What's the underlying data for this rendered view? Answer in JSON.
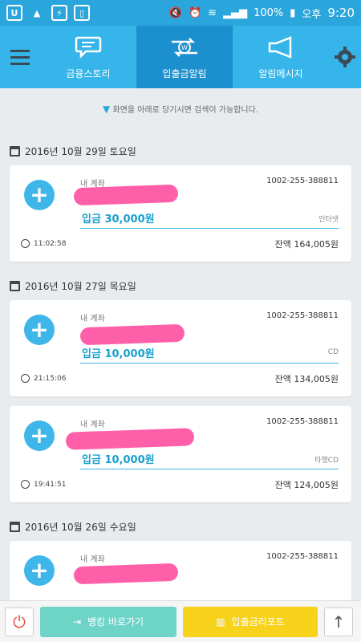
{
  "statusbar": {
    "battery": "100%",
    "ampm": "오후",
    "time": "9:20"
  },
  "tabs": [
    {
      "label": "금융스토리",
      "icon": "chat-bubble-icon"
    },
    {
      "label": "입출금알림",
      "icon": "exchange-icon"
    },
    {
      "label": "알림메시지",
      "icon": "megaphone-icon"
    }
  ],
  "hint": "화면을 아래로 당기시면 검색이 가능합니다.",
  "groups": [
    {
      "date": "2016년 10월 29일 토요일",
      "items": [
        {
          "label": "내 계좌",
          "account": "1002-255-388811",
          "amount": "입금 30,000원",
          "memo": "인터넷",
          "time": "11:02:58",
          "balance": "잔액 164,005원"
        }
      ]
    },
    {
      "date": "2016년 10월 27일 목요일",
      "items": [
        {
          "label": "내 계좌",
          "account": "1002-255-388811",
          "amount": "입금 10,000원",
          "memo": "CD",
          "time": "21:15:06",
          "balance": "잔액 134,005원"
        },
        {
          "label": "내 계좌",
          "account": "1002-255-388811",
          "amount": "입금 10,000원",
          "memo": "타행CD",
          "time": "19:41:51",
          "balance": "잔액 124,005원"
        }
      ]
    },
    {
      "date": "2016년 10월 26일 수요일",
      "items": [
        {
          "label": "내 계좌",
          "account": "1002-255-388811",
          "amount": "",
          "memo": "",
          "time": "",
          "balance": ""
        }
      ]
    }
  ],
  "bottom": {
    "bank_shortcut": "뱅킹 바로가기",
    "report": "입출금리포트"
  },
  "colors": {
    "header": "#35b5ea",
    "active_tab": "#1c8fce",
    "accent": "#3fb6ea",
    "bank": "#6fd4c8",
    "report": "#f7d21a"
  }
}
